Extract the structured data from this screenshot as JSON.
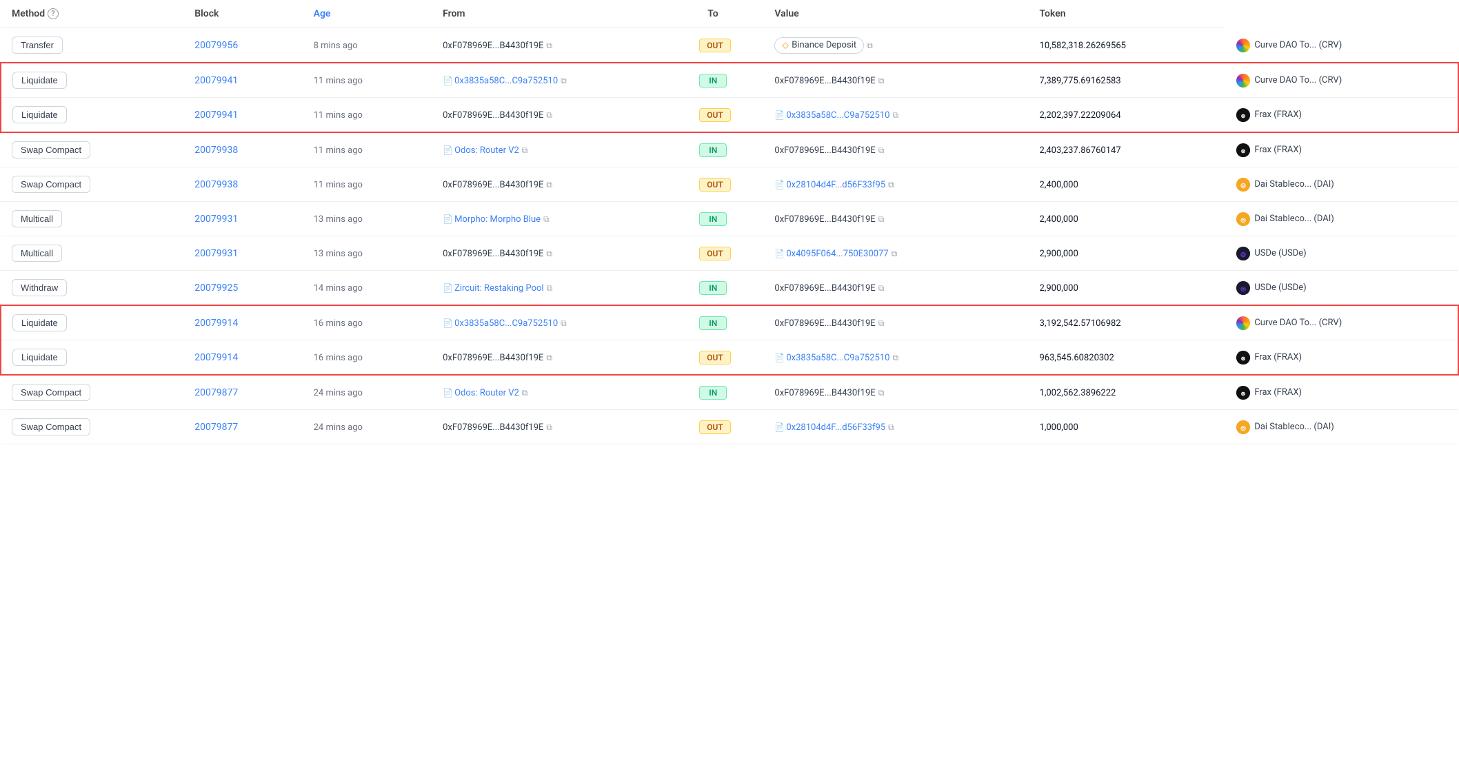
{
  "header": {
    "cols": [
      {
        "label": "Method",
        "hasHelp": true,
        "isBlue": false
      },
      {
        "label": "Block",
        "isBlue": false
      },
      {
        "label": "Age",
        "isBlue": true
      },
      {
        "label": "From",
        "isBlue": false
      },
      {
        "label": "To",
        "isBlue": false
      },
      {
        "label": "Value",
        "isBlue": false
      },
      {
        "label": "Token",
        "isBlue": false
      }
    ]
  },
  "rows": [
    {
      "id": "row-0",
      "method": "Transfer",
      "block": "20079956",
      "age": "8 mins ago",
      "from": {
        "text": "0xF078969E...B4430f19E",
        "isLink": false
      },
      "direction": "OUT",
      "to": {
        "text": "Binance Deposit",
        "isBinance": true
      },
      "value": "10,582,318.26269565",
      "token": {
        "name": "Curve DAO To... (CRV)",
        "type": "crv"
      },
      "group": null
    },
    {
      "id": "row-1",
      "method": "Liquidate",
      "block": "20079941",
      "age": "11 mins ago",
      "from": {
        "text": "0x3835a58C...C9a752510",
        "isLink": true
      },
      "direction": "IN",
      "to": {
        "text": "0xF078969E...B4430f19E",
        "isLink": false
      },
      "value": "7,389,775.69162583",
      "token": {
        "name": "Curve DAO To... (CRV)",
        "type": "crv"
      },
      "group": "group1-top"
    },
    {
      "id": "row-2",
      "method": "Liquidate",
      "block": "20079941",
      "age": "11 mins ago",
      "from": {
        "text": "0xF078969E...B4430f19E",
        "isLink": false
      },
      "direction": "OUT",
      "to": {
        "text": "0x3835a58C...C9a752510",
        "isLink": true
      },
      "value": "2,202,397.22209064",
      "token": {
        "name": "Frax (FRAX)",
        "type": "frax"
      },
      "group": "group1-bottom"
    },
    {
      "id": "row-3",
      "method": "Swap Compact",
      "block": "20079938",
      "age": "11 mins ago",
      "from": {
        "text": "Odos: Router V2",
        "isLink": true
      },
      "direction": "IN",
      "to": {
        "text": "0xF078969E...B4430f19E",
        "isLink": false
      },
      "value": "2,403,237.86760147",
      "token": {
        "name": "Frax (FRAX)",
        "type": "frax"
      },
      "group": null
    },
    {
      "id": "row-4",
      "method": "Swap Compact",
      "block": "20079938",
      "age": "11 mins ago",
      "from": {
        "text": "0xF078969E...B4430f19E",
        "isLink": false
      },
      "direction": "OUT",
      "to": {
        "text": "0x28104d4F...d56F33f95",
        "isLink": true
      },
      "value": "2,400,000",
      "token": {
        "name": "Dai Stableco... (DAI)",
        "type": "dai"
      },
      "group": null
    },
    {
      "id": "row-5",
      "method": "Multicall",
      "block": "20079931",
      "age": "13 mins ago",
      "from": {
        "text": "Morpho: Morpho Blue",
        "isLink": true
      },
      "direction": "IN",
      "to": {
        "text": "0xF078969E...B4430f19E",
        "isLink": false
      },
      "value": "2,400,000",
      "token": {
        "name": "Dai Stableco... (DAI)",
        "type": "dai"
      },
      "group": null
    },
    {
      "id": "row-6",
      "method": "Multicall",
      "block": "20079931",
      "age": "13 mins ago",
      "from": {
        "text": "0xF078969E...B4430f19E",
        "isLink": false
      },
      "direction": "OUT",
      "to": {
        "text": "0x4095F064...750E30077",
        "isLink": true
      },
      "value": "2,900,000",
      "token": {
        "name": "USDe (USDe)",
        "type": "usde"
      },
      "group": null
    },
    {
      "id": "row-7",
      "method": "Withdraw",
      "block": "20079925",
      "age": "14 mins ago",
      "from": {
        "text": "Zircuit: Restaking Pool",
        "isLink": true
      },
      "direction": "IN",
      "to": {
        "text": "0xF078969E...B4430f19E",
        "isLink": false
      },
      "value": "2,900,000",
      "token": {
        "name": "USDe (USDe)",
        "type": "usde"
      },
      "group": null
    },
    {
      "id": "row-8",
      "method": "Liquidate",
      "block": "20079914",
      "age": "16 mins ago",
      "from": {
        "text": "0x3835a58C...C9a752510",
        "isLink": true
      },
      "direction": "IN",
      "to": {
        "text": "0xF078969E...B4430f19E",
        "isLink": false
      },
      "value": "3,192,542.57106982",
      "token": {
        "name": "Curve DAO To... (CRV)",
        "type": "crv"
      },
      "group": "group2-top"
    },
    {
      "id": "row-9",
      "method": "Liquidate",
      "block": "20079914",
      "age": "16 mins ago",
      "from": {
        "text": "0xF078969E...B4430f19E",
        "isLink": false
      },
      "direction": "OUT",
      "to": {
        "text": "0x3835a58C...C9a752510",
        "isLink": true
      },
      "value": "963,545.60820302",
      "token": {
        "name": "Frax (FRAX)",
        "type": "frax"
      },
      "group": "group2-bottom"
    },
    {
      "id": "row-10",
      "method": "Swap Compact",
      "block": "20079877",
      "age": "24 mins ago",
      "from": {
        "text": "Odos: Router V2",
        "isLink": true
      },
      "direction": "IN",
      "to": {
        "text": "0xF078969E...B4430f19E",
        "isLink": false
      },
      "value": "1,002,562.3896222",
      "token": {
        "name": "Frax (FRAX)",
        "type": "frax"
      },
      "group": null
    },
    {
      "id": "row-11",
      "method": "Swap Compact",
      "block": "20079877",
      "age": "24 mins ago",
      "from": {
        "text": "0xF078969E...B4430f19E",
        "isLink": false
      },
      "direction": "OUT",
      "to": {
        "text": "0x28104d4F...d56F33f95",
        "isLink": true
      },
      "value": "1,000,000",
      "token": {
        "name": "Dai Stableco... (DAI)",
        "type": "dai"
      },
      "group": null
    }
  ]
}
